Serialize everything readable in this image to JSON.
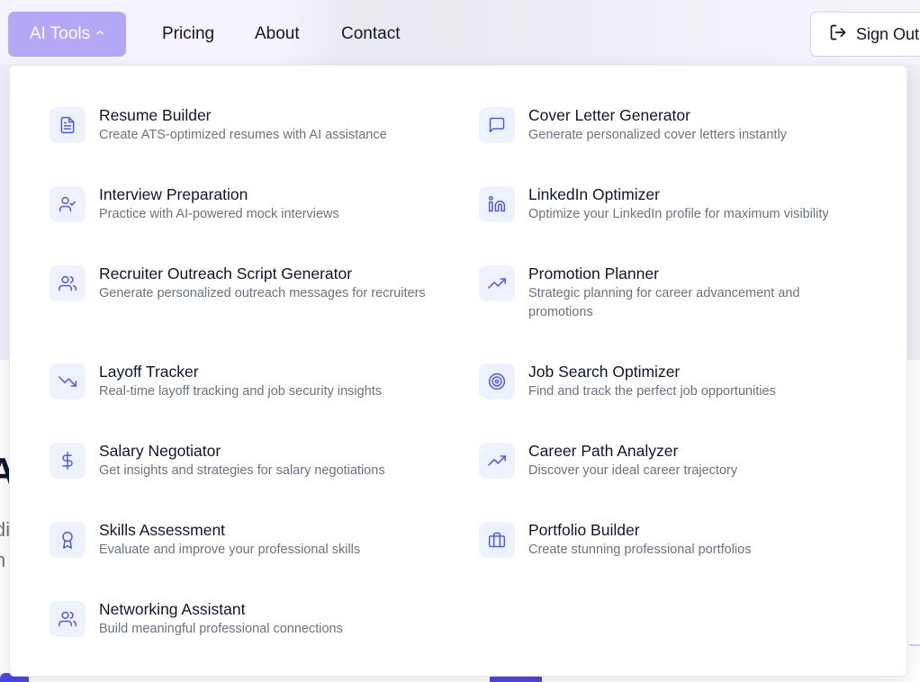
{
  "nav": {
    "ai_tools_label": "AI Tools",
    "pricing_label": "Pricing",
    "about_label": "About",
    "contact_label": "Contact",
    "sign_out_label": "Sign Out"
  },
  "background": {
    "heading_fragment": "A",
    "sub_fragment_1": "di",
    "sub_fragment_2": "n"
  },
  "menu": {
    "items": [
      {
        "title": "Resume Builder",
        "description": "Create ATS-optimized resumes with AI assistance",
        "icon": "document-icon"
      },
      {
        "title": "Cover Letter Generator",
        "description": "Generate personalized cover letters instantly",
        "icon": "message-square-icon"
      },
      {
        "title": "Interview Preparation",
        "description": "Practice with AI-powered mock interviews",
        "icon": "user-check-icon"
      },
      {
        "title": "LinkedIn Optimizer",
        "description": "Optimize your LinkedIn profile for maximum visibility",
        "icon": "linkedin-icon"
      },
      {
        "title": "Recruiter Outreach Script Generator",
        "description": "Generate personalized outreach messages for recruiters",
        "icon": "users-icon"
      },
      {
        "title": "Promotion Planner",
        "description": "Strategic planning for career advancement and promotions",
        "icon": "trending-up-icon"
      },
      {
        "title": "Layoff Tracker",
        "description": "Real-time layoff tracking and job security insights",
        "icon": "trending-down-icon"
      },
      {
        "title": "Job Search Optimizer",
        "description": "Find and track the perfect job opportunities",
        "icon": "target-icon"
      },
      {
        "title": "Salary Negotiator",
        "description": "Get insights and strategies for salary negotiations",
        "icon": "dollar-icon"
      },
      {
        "title": "Career Path Analyzer",
        "description": "Discover your ideal career trajectory",
        "icon": "trending-up-icon"
      },
      {
        "title": "Skills Assessment",
        "description": "Evaluate and improve your professional skills",
        "icon": "award-icon"
      },
      {
        "title": "Portfolio Builder",
        "description": "Create stunning professional portfolios",
        "icon": "briefcase-icon"
      },
      {
        "title": "Networking Assistant",
        "description": "Build meaningful professional connections",
        "icon": "users-icon"
      }
    ]
  },
  "colors": {
    "accent": "#b4a7f5",
    "icon_bg": "#eef2ff",
    "icon_stroke": "#4f5bd5"
  }
}
